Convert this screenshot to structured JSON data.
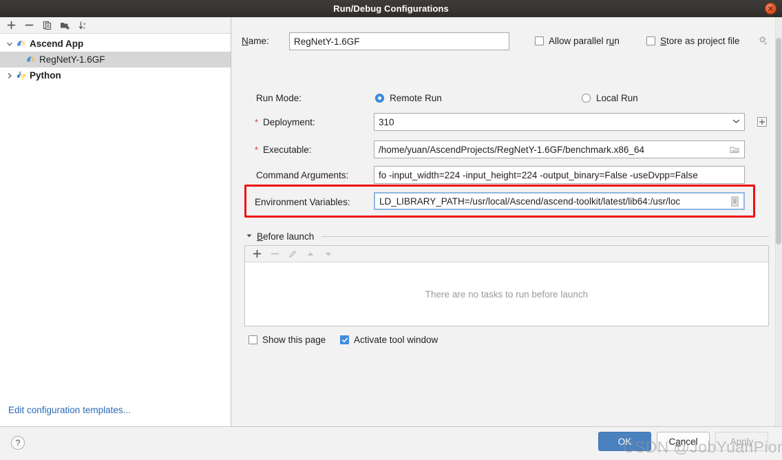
{
  "window": {
    "title": "Run/Debug Configurations",
    "close_icon": "close-icon"
  },
  "sidebar": {
    "toolbar": [
      {
        "name": "add-configuration-button",
        "icon": "plus-icon"
      },
      {
        "name": "remove-configuration-button",
        "icon": "minus-icon"
      },
      {
        "name": "copy-configuration-button",
        "icon": "copy-icon"
      },
      {
        "name": "move-into-folder-button",
        "icon": "folder-add-icon"
      },
      {
        "name": "sort-configurations-button",
        "icon": "sort-alpha-icon"
      }
    ],
    "tree": [
      {
        "label": "Ascend App",
        "icon": "ascend-app-icon",
        "expanded": true,
        "arrow": "˅",
        "selected": false,
        "child": false
      },
      {
        "label": "RegNetY-1.6GF",
        "icon": "ascend-app-icon",
        "expanded": false,
        "arrow": "",
        "selected": true,
        "child": true
      },
      {
        "label": "Python",
        "icon": "python-icon",
        "expanded": false,
        "arrow": "›",
        "selected": false,
        "child": false
      }
    ],
    "edit_templates_link": "Edit configuration templates..."
  },
  "form": {
    "name_label": "Name:",
    "name_label_prefix": "N",
    "name_label_rest": "ame:",
    "name_value": "RegNetY-1.6GF",
    "allow_parallel_run": {
      "label_prefix": "Allow parallel r",
      "label_mnemonic": "u",
      "label_suffix": "n",
      "checked": false
    },
    "store_as_project_file": {
      "label_mnemonic": "S",
      "label_rest": "tore as project file",
      "checked": false
    },
    "store_gear_icon": "gear-icon",
    "run_mode": {
      "label": "Run Mode:",
      "options": [
        {
          "label": "Remote Run",
          "selected": true
        },
        {
          "label": "Local Run",
          "selected": false
        }
      ]
    },
    "deployment": {
      "label": "Deployment:",
      "required": true,
      "value": "310",
      "dropdown_icon": "chevron-down-icon",
      "add_icon": "plus-box-icon"
    },
    "executable": {
      "label": "Executable:",
      "required": true,
      "value": "/home/yuan/AscendProjects/RegNetY-1.6GF/benchmark.x86_64",
      "browse_icon": "folder-icon"
    },
    "command_arguments": {
      "label": "Command Arguments:",
      "required": false,
      "value": "fo -input_width=224 -input_height=224 -output_binary=False -useDvpp=False"
    },
    "environment_variables": {
      "label": "Environment Variables:",
      "required": false,
      "value": "LD_LIBRARY_PATH=/usr/local/Ascend/ascend-toolkit/latest/lib64:/usr/loc",
      "expand_icon": "list-editor-icon",
      "highlighted": true,
      "highlight_color": "#ef0f13"
    }
  },
  "before_launch": {
    "title_mnemonic": "B",
    "title_rest": "efore launch",
    "collapse_icon": "triangle-down-icon",
    "toolbar": [
      {
        "name": "add-task-button",
        "icon": "plus-icon",
        "enabled": true
      },
      {
        "name": "remove-task-button",
        "icon": "minus-icon",
        "enabled": false
      },
      {
        "name": "edit-task-button",
        "icon": "pencil-icon",
        "enabled": false
      },
      {
        "name": "move-task-up-button",
        "icon": "triangle-up-icon",
        "enabled": false
      },
      {
        "name": "move-task-down-button",
        "icon": "triangle-down-icon",
        "enabled": false
      }
    ],
    "empty_text": "There are no tasks to run before launch",
    "show_this_page": {
      "label": "Show this page",
      "checked": false
    },
    "activate_tool_window": {
      "label": "Activate tool window",
      "checked": true
    }
  },
  "footer": {
    "help_label": "?",
    "ok_label": "OK",
    "cancel_prefix": "C",
    "cancel_mnemonic": "a",
    "cancel_rest": "ncel",
    "cancel_label": "Cancel",
    "apply_label": "Apply"
  },
  "watermark": "CSDN @JobYuanPioneer",
  "colors": {
    "titlebar": "#383431",
    "accent_blue": "#3f8ee0",
    "ok_button": "#4b81bf",
    "link": "#2a6ab5",
    "required_asterisk": "#d33b38",
    "highlight_red": "#ef0f13",
    "selection_gray": "#d6d6d6"
  }
}
